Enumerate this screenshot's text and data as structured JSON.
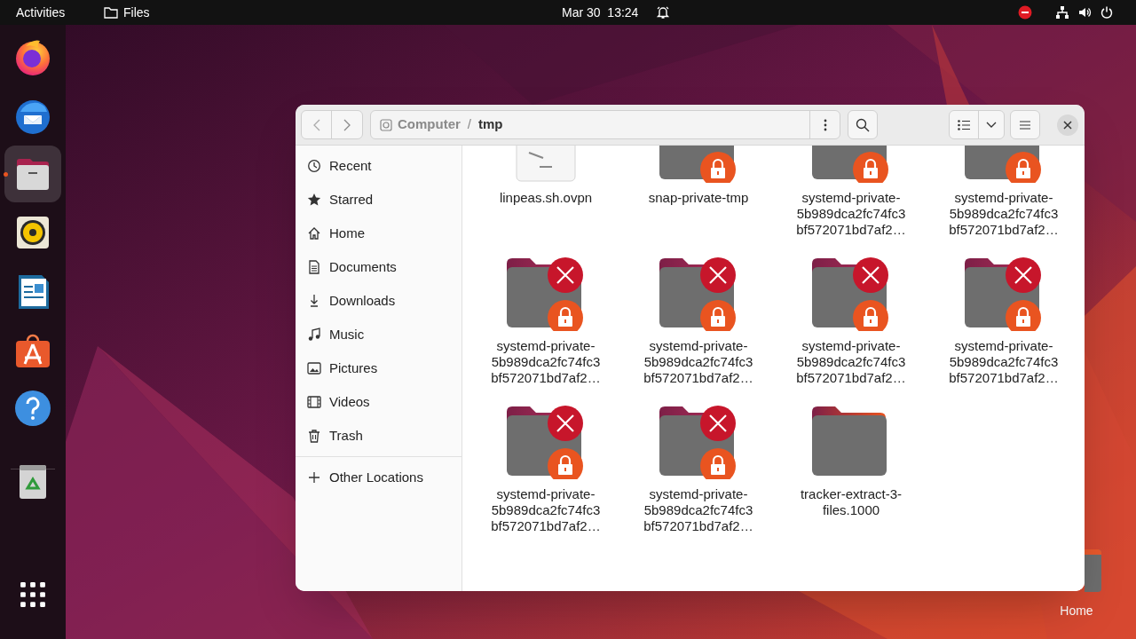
{
  "top_bar": {
    "activities": "Activities",
    "app_name": "Files",
    "clock": "Mar 30  13:24"
  },
  "dock": {
    "items": [
      {
        "kind": "firefox",
        "running": false
      },
      {
        "kind": "thunderbird",
        "running": false
      },
      {
        "kind": "files",
        "running": true
      },
      {
        "kind": "rhythmbox",
        "running": false
      },
      {
        "kind": "writer",
        "running": false
      },
      {
        "kind": "appcenter",
        "running": false
      },
      {
        "kind": "help",
        "running": false
      },
      {
        "kind": "trash",
        "running": false
      },
      {
        "kind": "appgrid",
        "running": false
      }
    ]
  },
  "desktop_icons": [
    {
      "label": "Home"
    }
  ],
  "window": {
    "path": [
      {
        "label": "Computer",
        "kind": "device"
      },
      {
        "label": "tmp",
        "kind": "folder"
      }
    ],
    "separator": "/"
  },
  "sidebar": {
    "items": [
      {
        "label": "Recent",
        "kind": "recent",
        "selected": false
      },
      {
        "label": "Starred",
        "kind": "starred",
        "selected": false
      },
      {
        "label": "Home",
        "kind": "home",
        "selected": false
      },
      {
        "label": "Documents",
        "kind": "documents",
        "selected": false
      },
      {
        "label": "Downloads",
        "kind": "downloads",
        "selected": false
      },
      {
        "label": "Music",
        "kind": "music",
        "selected": false
      },
      {
        "label": "Pictures",
        "kind": "pictures",
        "selected": false
      },
      {
        "label": "Videos",
        "kind": "videos",
        "selected": false
      },
      {
        "label": "Trash",
        "kind": "trash",
        "selected": false
      }
    ],
    "other": {
      "label": "Other Locations"
    }
  },
  "files": [
    {
      "name": "linpeas.sh.ovpn",
      "kind": "file"
    },
    {
      "name": "snap-private-tmp",
      "kind": "folder",
      "locked": true
    },
    {
      "name": "systemd-private-5b989dca2fc74fc3bf572071bd7af2…",
      "kind": "folder",
      "locked": true
    },
    {
      "name": "systemd-private-5b989dca2fc74fc3bf572071bd7af2…",
      "kind": "folder",
      "locked": true
    },
    {
      "name": "systemd-private-5b989dca2fc74fc3bf572071bd7af2…",
      "kind": "folder",
      "locked": true,
      "unreadable": true
    },
    {
      "name": "systemd-private-5b989dca2fc74fc3bf572071bd7af2…",
      "kind": "folder",
      "locked": true,
      "unreadable": true
    },
    {
      "name": "systemd-private-5b989dca2fc74fc3bf572071bd7af2…",
      "kind": "folder",
      "locked": true,
      "unreadable": true
    },
    {
      "name": "systemd-private-5b989dca2fc74fc3bf572071bd7af2…",
      "kind": "folder",
      "locked": true,
      "unreadable": true
    },
    {
      "name": "systemd-private-5b989dca2fc74fc3bf572071bd7af2…",
      "kind": "folder",
      "locked": true,
      "unreadable": true
    },
    {
      "name": "systemd-private-5b989dca2fc74fc3bf572071bd7af2…",
      "kind": "folder",
      "locked": true,
      "unreadable": true
    },
    {
      "name": "tracker-extract-3-files.1000",
      "kind": "folder",
      "locked": false,
      "unreadable": false
    }
  ]
}
